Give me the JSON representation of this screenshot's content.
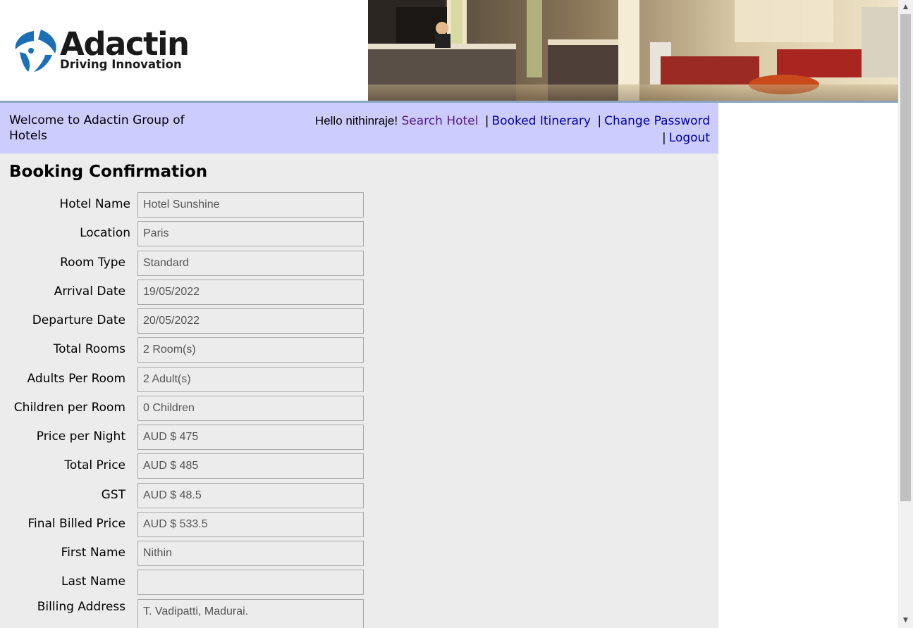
{
  "brand": {
    "name": "Adactin",
    "tagline": "Driving Innovation"
  },
  "nav": {
    "welcome": "Welcome to Adactin Group of Hotels",
    "hello": "Hello nithinraje!",
    "links": {
      "search_hotel": "Search Hotel",
      "booked_itinerary": "Booked Itinerary",
      "change_password": "Change Password",
      "logout": "Logout"
    },
    "separator": "|"
  },
  "page": {
    "title": "Booking Confirmation"
  },
  "fields": [
    {
      "label": "Hotel Name",
      "value": "Hotel Sunshine"
    },
    {
      "label": "Location",
      "value": "Paris"
    },
    {
      "label": "Room Type",
      "value": "Standard"
    },
    {
      "label": "Arrival Date",
      "value": "19/05/2022"
    },
    {
      "label": "Departure Date",
      "value": "20/05/2022"
    },
    {
      "label": "Total Rooms",
      "value": "2 Room(s)"
    },
    {
      "label": "Adults Per Room",
      "value": "2 Adult(s)"
    },
    {
      "label": "Children per Room",
      "value": "0 Children"
    },
    {
      "label": "Price per Night",
      "value": "AUD $ 475"
    },
    {
      "label": "Total Price",
      "value": "AUD $ 485"
    },
    {
      "label": "GST",
      "value": "AUD $ 48.5"
    },
    {
      "label": "Final Billed Price",
      "value": "AUD $ 533.5"
    },
    {
      "label": "First Name",
      "value": "Nithin"
    },
    {
      "label": "Last Name",
      "value": ""
    },
    {
      "label": "Billing Address",
      "value": "T. Vadipatti, Madurai."
    }
  ],
  "colors": {
    "navbar_bg": "#ccccff",
    "content_bg": "#ececec",
    "link": "#0000a8",
    "link_visited": "#551a8b",
    "logo_blue": "#1a6fb5"
  },
  "icons": {
    "logo": "adactin-swirl-logo",
    "scroll_up": "triangle-up-icon",
    "scroll_down": "triangle-down-icon"
  }
}
